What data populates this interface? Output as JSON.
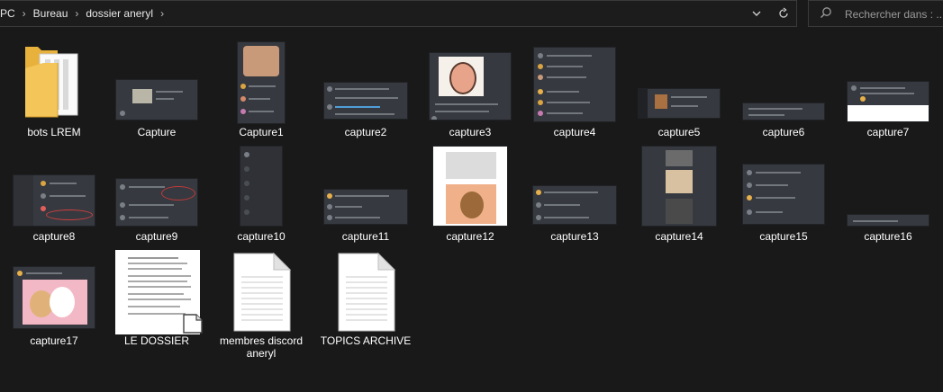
{
  "address": {
    "crumbs": [
      "PC",
      "Bureau",
      "dossier aneryl"
    ]
  },
  "search": {
    "placeholder": "Rechercher dans : ..."
  },
  "items": [
    {
      "label": "bots LREM",
      "type": "folder"
    },
    {
      "label": "Capture",
      "type": "image"
    },
    {
      "label": "Capture1",
      "type": "image"
    },
    {
      "label": "capture2",
      "type": "image"
    },
    {
      "label": "capture3",
      "type": "image"
    },
    {
      "label": "capture4",
      "type": "image"
    },
    {
      "label": "capture5",
      "type": "image"
    },
    {
      "label": "capture6",
      "type": "image"
    },
    {
      "label": "capture7",
      "type": "image"
    },
    {
      "label": "capture8",
      "type": "image"
    },
    {
      "label": "capture9",
      "type": "image"
    },
    {
      "label": "capture10",
      "type": "image"
    },
    {
      "label": "capture11",
      "type": "image"
    },
    {
      "label": "capture12",
      "type": "image"
    },
    {
      "label": "capture13",
      "type": "image"
    },
    {
      "label": "capture14",
      "type": "image"
    },
    {
      "label": "capture15",
      "type": "image"
    },
    {
      "label": "capture16",
      "type": "image"
    },
    {
      "label": "capture17",
      "type": "image"
    },
    {
      "label": "LE DOSSIER",
      "type": "document"
    },
    {
      "label": "membres discord aneryl",
      "type": "text"
    },
    {
      "label": "TOPICS ARCHIVE",
      "type": "text"
    }
  ],
  "colors": {
    "background": "#191919",
    "discord_bg": "#36393f",
    "folder": "#f4c65a"
  }
}
